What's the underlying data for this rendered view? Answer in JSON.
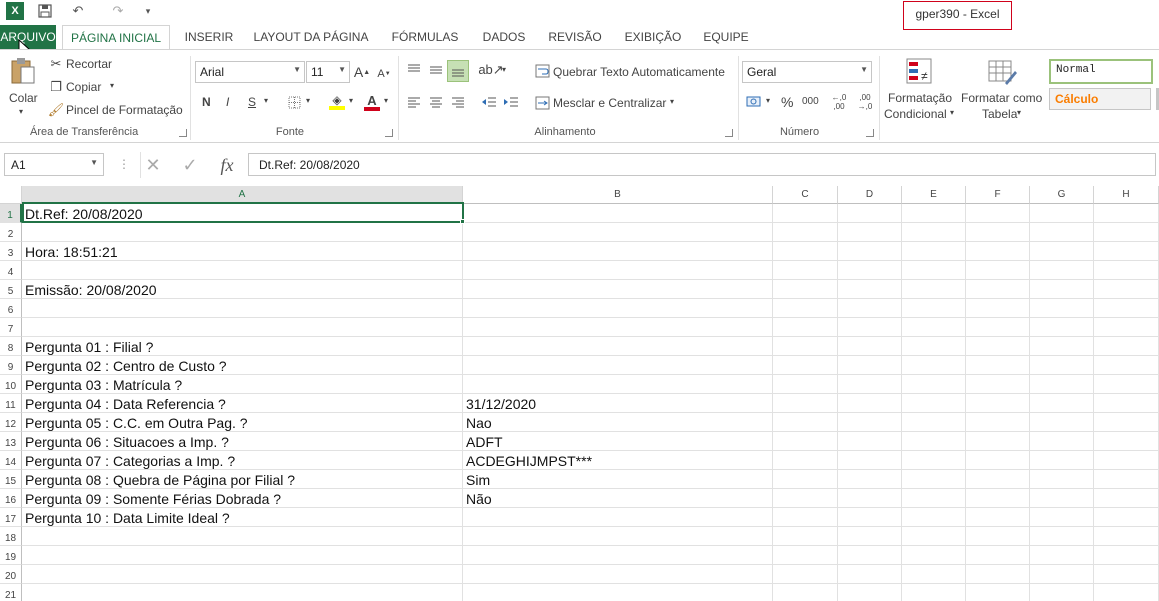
{
  "window": {
    "title": "gper390 - Excel"
  },
  "qat": {
    "undo": "↶",
    "redo": "↷"
  },
  "tabs": [
    "ARQUIVO",
    "PÁGINA INICIAL",
    "INSERIR",
    "LAYOUT DA PÁGINA",
    "FÓRMULAS",
    "DADOS",
    "REVISÃO",
    "EXIBIÇÃO",
    "EQUIPE"
  ],
  "ribbon": {
    "clipboard": {
      "paste": "Colar",
      "cut": "Recortar",
      "copy": "Copiar",
      "format_painter": "Pincel de Formatação",
      "label": "Área de Transferência"
    },
    "font": {
      "name": "Arial",
      "size": "11",
      "bold": "N",
      "italic": "I",
      "underline": "S",
      "label": "Fonte"
    },
    "alignment": {
      "wrap": "Quebrar Texto Automaticamente",
      "merge": "Mesclar e Centralizar",
      "label": "Alinhamento"
    },
    "number": {
      "format": "Geral",
      "percent": "%",
      "thousands": "000",
      "label": "Número"
    },
    "styles": {
      "conditional_1": "Formatação",
      "conditional_2": "Condicional",
      "table_1": "Formatar como",
      "table_2": "Tabela",
      "normal": "Normal",
      "calc": "Cálculo"
    }
  },
  "formula_bar": {
    "name_box": "A1",
    "content": "Dt.Ref: 20/08/2020"
  },
  "columns": [
    "A",
    "B",
    "C",
    "D",
    "E",
    "F",
    "G",
    "H"
  ],
  "rows": [
    {
      "n": "1",
      "a": "Dt.Ref: 20/08/2020",
      "b": ""
    },
    {
      "n": "2",
      "a": "",
      "b": ""
    },
    {
      "n": "3",
      "a": "Hora: 18:51:21",
      "b": ""
    },
    {
      "n": "4",
      "a": "",
      "b": ""
    },
    {
      "n": "5",
      "a": "Emissão: 20/08/2020",
      "b": ""
    },
    {
      "n": "6",
      "a": "",
      "b": ""
    },
    {
      "n": "7",
      "a": "",
      "b": ""
    },
    {
      "n": "8",
      "a": "Pergunta 01 : Filial ?",
      "b": ""
    },
    {
      "n": "9",
      "a": "Pergunta 02 : Centro de Custo ?",
      "b": ""
    },
    {
      "n": "10",
      "a": "Pergunta 03 : Matrícula ?",
      "b": ""
    },
    {
      "n": "11",
      "a": "Pergunta 04 : Data Referencia ?",
      "b": "31/12/2020"
    },
    {
      "n": "12",
      "a": "Pergunta 05 : C.C. em Outra Pag. ?",
      "b": "Nao"
    },
    {
      "n": "13",
      "a": "Pergunta 06 : Situacoes a Imp. ?",
      "b": " ADFT"
    },
    {
      "n": "14",
      "a": "Pergunta 07 : Categorias a Imp. ?",
      "b": "ACDEGHIJMPST***"
    },
    {
      "n": "15",
      "a": "Pergunta 08 : Quebra de Página por Filial ?",
      "b": "Sim"
    },
    {
      "n": "16",
      "a": "Pergunta 09 : Somente Férias Dobrada ?",
      "b": "Não"
    },
    {
      "n": "17",
      "a": "Pergunta 10 : Data Limite Ideal ?",
      "b": ""
    },
    {
      "n": "18",
      "a": "",
      "b": ""
    },
    {
      "n": "19",
      "a": "",
      "b": ""
    },
    {
      "n": "20",
      "a": "",
      "b": ""
    },
    {
      "n": "21",
      "a": "",
      "b": ""
    }
  ],
  "colors": {
    "accent": "#217346",
    "calc_text": "#fa7d00",
    "highlight": "#d0021b"
  }
}
